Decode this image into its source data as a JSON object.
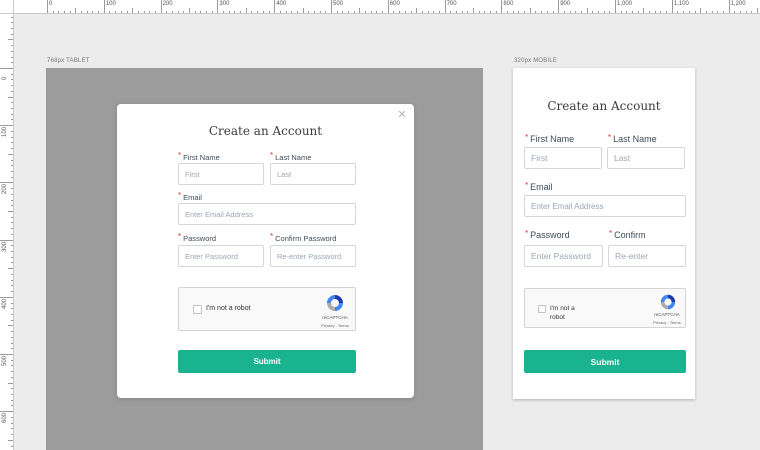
{
  "ruler": {
    "top_labels": [
      "0",
      "100",
      "200",
      "300",
      "400",
      "500",
      "600",
      "700",
      "800",
      "900",
      "1,000",
      "1,100",
      "1,200"
    ],
    "left_labels": [
      "0",
      "100",
      "200",
      "300",
      "400",
      "500",
      "600"
    ]
  },
  "artboards": {
    "tablet_label": "768px TABLET",
    "mobile_label": "320px MOBILE"
  },
  "form": {
    "title": "Create an Account",
    "close_glyph": "✕",
    "required_mark": "*",
    "first_name_label": "First Name",
    "first_name_placeholder": "First",
    "last_name_label": "Last Name",
    "last_name_placeholder": "Last",
    "email_label": "Email",
    "email_placeholder": "Enter Email Address",
    "password_label": "Password",
    "password_placeholder": "Enter Password",
    "confirm_label": "Confirm Password",
    "confirm_label_short": "Confirm",
    "confirm_placeholder": "Re-enter Password",
    "confirm_placeholder_short": "Re-enter",
    "captcha_text": "I'm not a robot",
    "captcha_line1": "I'm not a",
    "captcha_line2": "robot",
    "captcha_brand": "reCAPTCHA",
    "captcha_terms": "Privacy - Terms",
    "submit_label": "Submit"
  },
  "colors": {
    "accent": "#19b38f",
    "required": "#e03c2f",
    "overlay": "#9c9c9c"
  }
}
